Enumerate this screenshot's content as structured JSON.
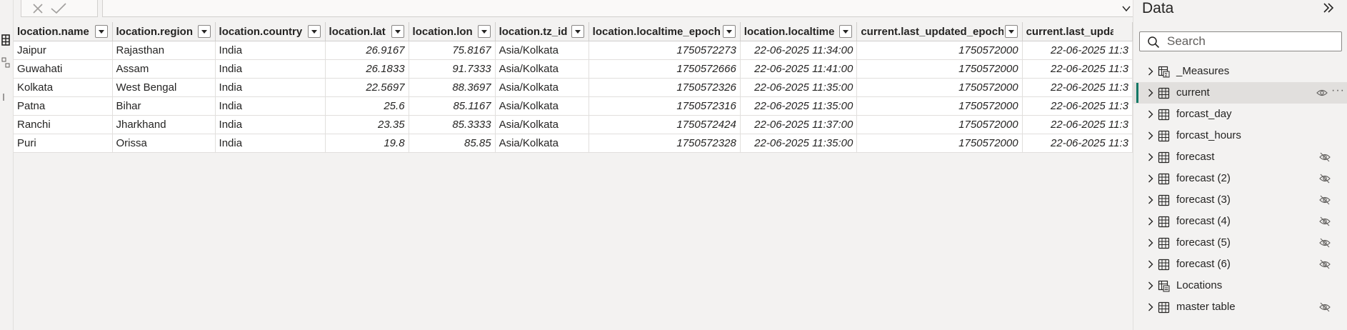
{
  "formula_bar": {
    "cancel_icon": "x-icon",
    "commit_icon": "check-icon",
    "value": ""
  },
  "table": {
    "columns": [
      "location.name",
      "location.region",
      "location.country",
      "location.lat",
      "location.lon",
      "location.tz_id",
      "location.localtime_epoch",
      "location.localtime",
      "current.last_updated_epoch",
      "current.last_updated"
    ],
    "rows": [
      [
        "Jaipur",
        "Rajasthan",
        "India",
        "26.9167",
        "75.8167",
        "Asia/Kolkata",
        "1750572273",
        "22-06-2025 11:34:00",
        "1750572000",
        "22-06-2025 11:3"
      ],
      [
        "Guwahati",
        "Assam",
        "India",
        "26.1833",
        "91.7333",
        "Asia/Kolkata",
        "1750572666",
        "22-06-2025 11:41:00",
        "1750572000",
        "22-06-2025 11:3"
      ],
      [
        "Kolkata",
        "West Bengal",
        "India",
        "22.5697",
        "88.3697",
        "Asia/Kolkata",
        "1750572326",
        "22-06-2025 11:35:00",
        "1750572000",
        "22-06-2025 11:3"
      ],
      [
        "Patna",
        "Bihar",
        "India",
        "25.6",
        "85.1167",
        "Asia/Kolkata",
        "1750572316",
        "22-06-2025 11:35:00",
        "1750572000",
        "22-06-2025 11:3"
      ],
      [
        "Ranchi",
        "Jharkhand",
        "India",
        "23.35",
        "85.3333",
        "Asia/Kolkata",
        "1750572424",
        "22-06-2025 11:37:00",
        "1750572000",
        "22-06-2025 11:3"
      ],
      [
        "Puri",
        "Orissa",
        "India",
        "19.8",
        "85.85",
        "Asia/Kolkata",
        "1750572328",
        "22-06-2025 11:35:00",
        "1750572000",
        "22-06-2025 11:3"
      ]
    ],
    "numeric_columns": [
      3,
      4,
      6,
      7,
      8,
      9
    ]
  },
  "data_pane": {
    "title": "Data",
    "collapse_icon": "double-chevron-right-icon",
    "search": {
      "placeholder": "Search",
      "value": ""
    },
    "tables": [
      {
        "label": "_Measures",
        "icon": "measure-table-icon",
        "hidden": false,
        "selected": false
      },
      {
        "label": "current",
        "icon": "table-icon",
        "hidden": false,
        "selected": true
      },
      {
        "label": "forcast_day",
        "icon": "table-icon",
        "hidden": false,
        "selected": false
      },
      {
        "label": "forcast_hours",
        "icon": "table-icon",
        "hidden": false,
        "selected": false
      },
      {
        "label": "forecast",
        "icon": "table-icon",
        "hidden": true,
        "selected": false
      },
      {
        "label": "forecast (2)",
        "icon": "table-icon",
        "hidden": true,
        "selected": false
      },
      {
        "label": "forecast (3)",
        "icon": "table-icon",
        "hidden": true,
        "selected": false
      },
      {
        "label": "forecast (4)",
        "icon": "table-icon",
        "hidden": true,
        "selected": false
      },
      {
        "label": "forecast (5)",
        "icon": "table-icon",
        "hidden": true,
        "selected": false
      },
      {
        "label": "forecast (6)",
        "icon": "table-icon",
        "hidden": true,
        "selected": false
      },
      {
        "label": "Locations",
        "icon": "calculated-table-icon",
        "hidden": false,
        "selected": false
      },
      {
        "label": "master table",
        "icon": "table-icon",
        "hidden": true,
        "selected": false
      }
    ],
    "more_label": "···"
  },
  "colors": {
    "accent": "#117865",
    "background": "#f3f2f1",
    "grid_line": "#e1dfdd",
    "text": "#252423"
  }
}
